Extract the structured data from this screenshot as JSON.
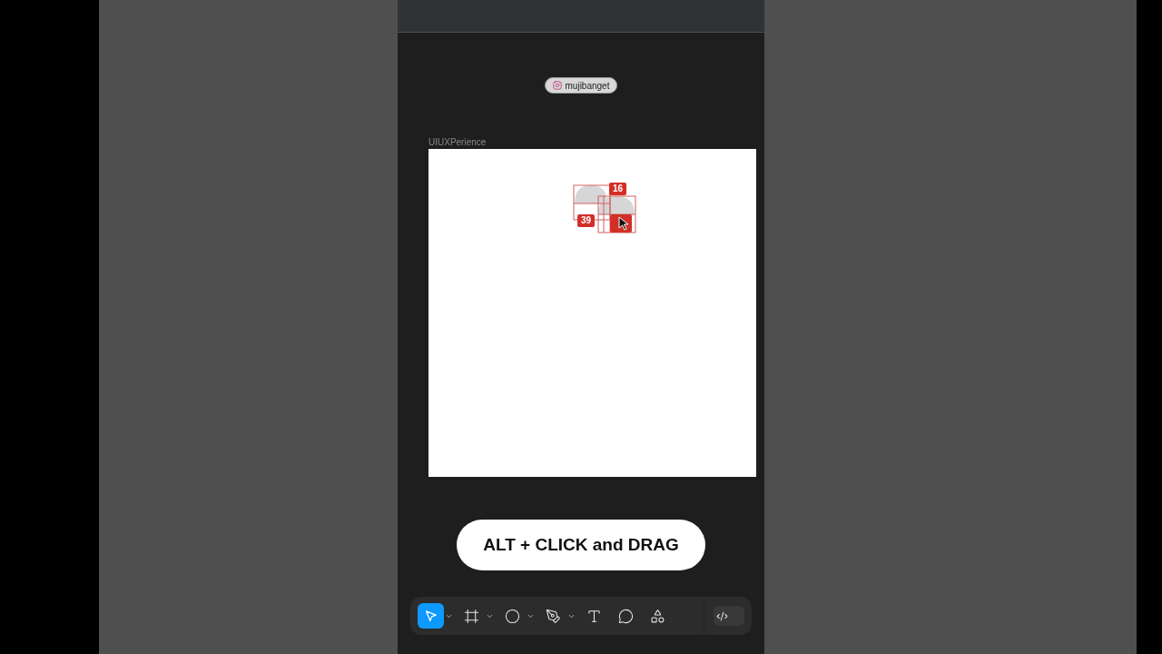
{
  "badge": {
    "handle": "mujibanget"
  },
  "frame": {
    "name": "UIUXPerience",
    "measurements": [
      {
        "value": "16"
      },
      {
        "value": "39"
      }
    ]
  },
  "caption": "ALT + CLICK and DRAG",
  "toolbar": {
    "tools": [
      {
        "kind": "move",
        "selected": true,
        "dropdown": true
      },
      {
        "kind": "frame",
        "selected": false,
        "dropdown": true
      },
      {
        "kind": "shape",
        "selected": false,
        "dropdown": true
      },
      {
        "kind": "pen",
        "selected": false,
        "dropdown": true
      },
      {
        "kind": "text",
        "selected": false,
        "dropdown": false
      },
      {
        "kind": "comment",
        "selected": false,
        "dropdown": false
      },
      {
        "kind": "components",
        "selected": false,
        "dropdown": false
      }
    ],
    "dev_mode": {
      "on": false
    }
  }
}
